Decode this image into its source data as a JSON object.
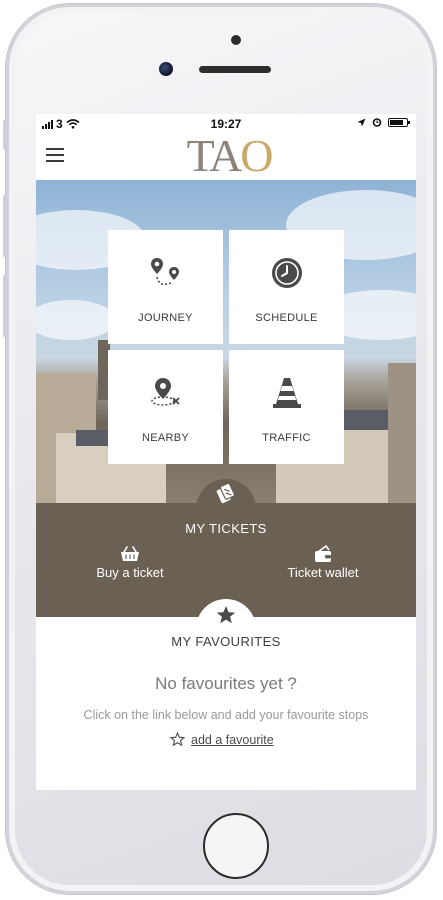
{
  "status_bar": {
    "carrier": "3",
    "time": "19:27"
  },
  "header": {
    "logo_text": "TA",
    "logo_accent": "O"
  },
  "tiles": [
    {
      "label": "JOURNEY",
      "icon": "route-pins-icon"
    },
    {
      "label": "SCHEDULE",
      "icon": "clock-icon"
    },
    {
      "label": "NEARBY",
      "icon": "map-pin-icon"
    },
    {
      "label": "TRAFFIC",
      "icon": "traffic-cone-icon"
    }
  ],
  "tickets": {
    "title": "MY TICKETS",
    "buy_label": "Buy a ticket",
    "wallet_label": "Ticket wallet"
  },
  "favourites": {
    "title": "MY FAVOURITES",
    "empty_text": "No favourites yet ?",
    "hint": "Click on the link below and add your favourite stops",
    "add_link": "add a favourite"
  },
  "colors": {
    "brand_brown": "#6b6054",
    "logo_grey": "#8b8279",
    "logo_gold": "#c9a96a"
  }
}
